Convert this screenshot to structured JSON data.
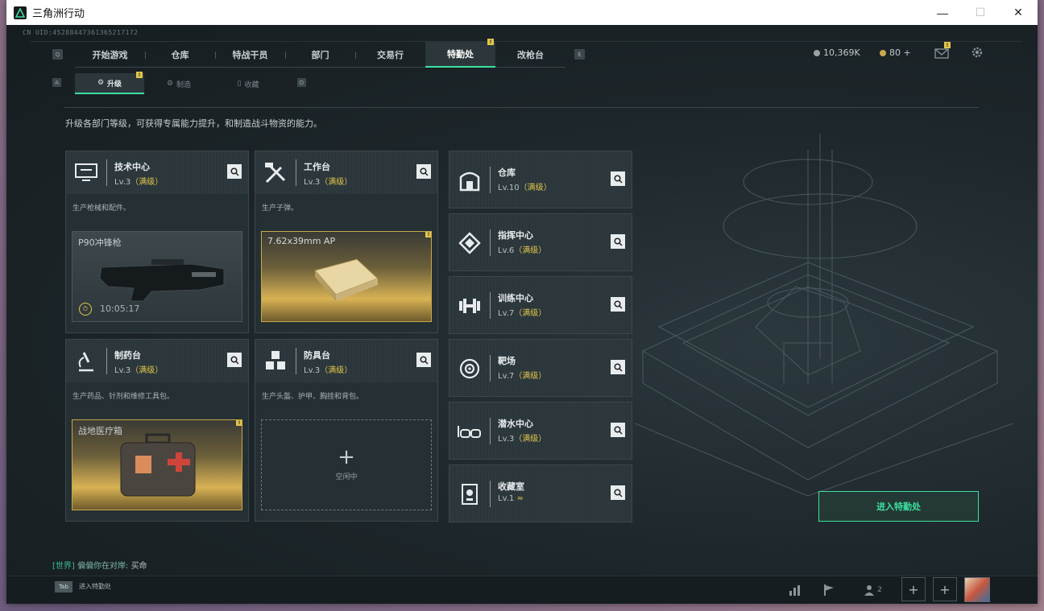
{
  "window": {
    "title": "三角洲行动",
    "minimize": "—",
    "maximize": "☐",
    "close": "✕"
  },
  "uid": "CN UID:4528844736136521717​2",
  "nav": {
    "left_key": "Q",
    "right_key": "E",
    "items": [
      {
        "label": "开始游戏"
      },
      {
        "label": "仓库"
      },
      {
        "label": "特战干员"
      },
      {
        "label": "部门"
      },
      {
        "label": "交易行"
      },
      {
        "label": "特勤处",
        "active": true,
        "badge": "!"
      },
      {
        "label": "改枪台"
      }
    ]
  },
  "currency": {
    "silver": "10,369K",
    "gold": "80 +",
    "mail_badge": "!"
  },
  "subnav": {
    "left_key": "A",
    "right_key": "D",
    "items": [
      {
        "label": "升级",
        "active": true,
        "badge": "!"
      },
      {
        "label": "制造"
      },
      {
        "label": "收藏"
      }
    ]
  },
  "intro": "升级各部门等级，可获得专属能力提升，和制造战斗物资的能力。",
  "big_cards": [
    {
      "name": "技术中心",
      "lv": "Lv.3",
      "max": "（满级）",
      "desc": "生产枪械和配件。",
      "product": "P90冲锋枪",
      "timer": "10:05:17",
      "style": "grey"
    },
    {
      "name": "工作台",
      "lv": "Lv.3",
      "max": "（满级）",
      "desc": "生产子弹。",
      "product": "7.62x39mm AP",
      "badge": "!",
      "style": "gold"
    },
    {
      "name": "制药台",
      "lv": "Lv.3",
      "max": "（满级）",
      "desc": "生产药品、针剂和维修工具包。",
      "product": "战地医疗箱",
      "badge": "!",
      "style": "gold"
    },
    {
      "name": "防具台",
      "lv": "Lv.3",
      "max": "（满级）",
      "desc": "生产头盔、护甲、胸挂和背包。",
      "idle": "空闲中",
      "style": "idle"
    }
  ],
  "small_cards": [
    {
      "name": "仓库",
      "lv": "Lv.10",
      "max": "（满级）"
    },
    {
      "name": "指挥中心",
      "lv": "Lv.6",
      "max": "（满级）"
    },
    {
      "name": "训练中心",
      "lv": "Lv.7",
      "max": "（满级）"
    },
    {
      "name": "靶场",
      "lv": "Lv.7",
      "max": "（满级）"
    },
    {
      "name": "潜水中心",
      "lv": "Lv.3",
      "max": "（满级）"
    },
    {
      "name": "收藏室",
      "lv": "Lv.1",
      "max": "≈"
    }
  ],
  "enter_button": "进入特勤处",
  "chat": {
    "channel": "[世界]",
    "name": "偏偏你在对岸:",
    "message": "买命"
  },
  "bottom": {
    "tab_key": "Tab",
    "tab_text": "进入特勤处",
    "friends_count": "2"
  },
  "colors": {
    "accent": "#3be0a0",
    "gold": "#e2c64c",
    "bg": "#1b2327"
  }
}
